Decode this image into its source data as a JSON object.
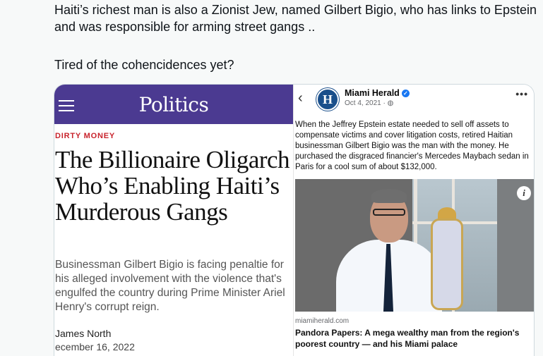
{
  "tweet": {
    "paragraph1": "Haiti’s richest man is also a Zionist Jew, named Gilbert Bigio, who has links to Epstein and was responsible for arming street gangs ..",
    "paragraph2": "Tired of the cohencidences yet?"
  },
  "left_article": {
    "section": "Politics",
    "kicker": "DIRTY MONEY",
    "headline": "The Billionaire Oligarch Who’s Enabling Haiti’s Murderous Gangs",
    "dek": "Businessman Gilbert Bigio is facing penaltie for his alleged involvement with the violence that's engulfed the country during Prime Minister Ariel Henry's corrupt reign.",
    "author": "James North",
    "date": "ecember 16, 2022",
    "banner_color": "#4b3a91",
    "kicker_color": "#c8232c"
  },
  "right_post": {
    "avatar_letter": "H",
    "page_name": "Miami Herald",
    "verified_glyph": "✓",
    "post_date": "Oct 4, 2021 · ◍",
    "text": "When the Jeffrey Epstein estate needed to sell off assets to compensate victims and cover litigation costs, retired Haitian businessman Gilbert Bigio was the man with the money. He purchased the disgraced financier's Mercedes Maybach sedan in Paris for a cool sum of about $132,000.",
    "link_domain": "miamiherald.com",
    "link_title": "Pandora Papers: A mega wealthy man from the region's poorest country — and his Miami palace",
    "back_glyph": "‹",
    "more_glyph": "•••",
    "info_glyph": "i"
  }
}
